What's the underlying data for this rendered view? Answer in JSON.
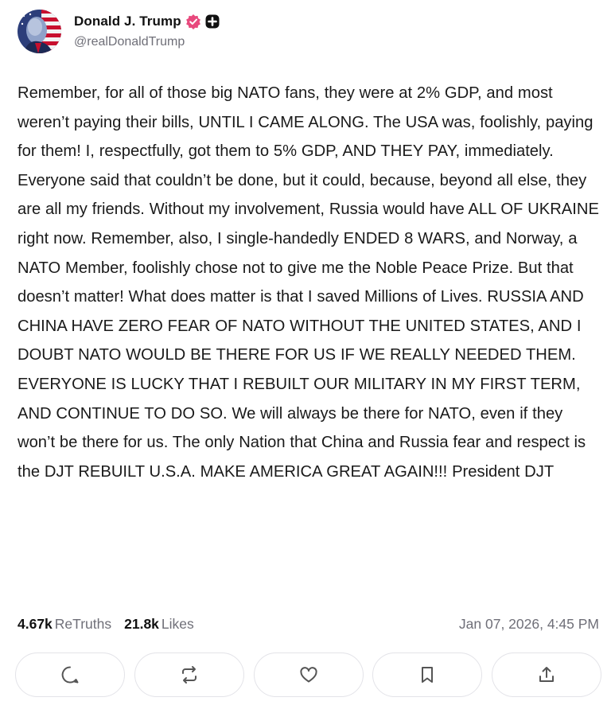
{
  "author": {
    "display_name": "Donald J. Trump",
    "handle": "@realDonaldTrump",
    "avatar_icon": "portrait-flag-avatar",
    "verified_icon": "verified-badge-icon",
    "verified_color": "#e8497d",
    "extra_badge_icon": "plus-badge-icon"
  },
  "post": {
    "text": "Remember, for all of those big NATO fans, they were at 2% GDP, and most weren’t paying their bills, UNTIL I CAME ALONG. The USA was, foolishly, paying for them! I, respectfully, got them to 5% GDP, AND THEY PAY, immediately. Everyone said that couldn’t be done, but it could, because, beyond all else, they are all my friends. Without my involvement, Russia would have ALL OF UKRAINE right now. Remember, also, I single-handedly ENDED 8 WARS, and Norway, a NATO Member, foolishly chose not to give me the Noble Peace Prize. But that doesn’t matter! What does matter is that I saved Millions of Lives. RUSSIA AND CHINA HAVE ZERO FEAR OF NATO WITHOUT THE UNITED STATES, AND I DOUBT NATO WOULD BE THERE FOR US IF WE REALLY NEEDED THEM. EVERYONE IS LUCKY THAT I REBUILT OUR MILITARY IN MY FIRST TERM, AND CONTINUE TO DO SO. We will always be there for NATO, even if they won’t be there for us. The only Nation that China and Russia fear and respect is the DJT REBUILT U.S.A. MAKE AMERICA GREAT AGAIN!!! President DJT"
  },
  "stats": {
    "retruths_count": "4.67k",
    "retruths_label": "ReTruths",
    "likes_count": "21.8k",
    "likes_label": "Likes",
    "timestamp": "Jan 07, 2026, 4:45 PM"
  },
  "actions": [
    {
      "icon": "reply-icon"
    },
    {
      "icon": "retruth-icon"
    },
    {
      "icon": "heart-icon"
    },
    {
      "icon": "bookmark-icon"
    },
    {
      "icon": "share-icon"
    }
  ],
  "colors": {
    "text": "#1a1a1a",
    "muted": "#6f6f78",
    "border": "#e3e3e8"
  }
}
